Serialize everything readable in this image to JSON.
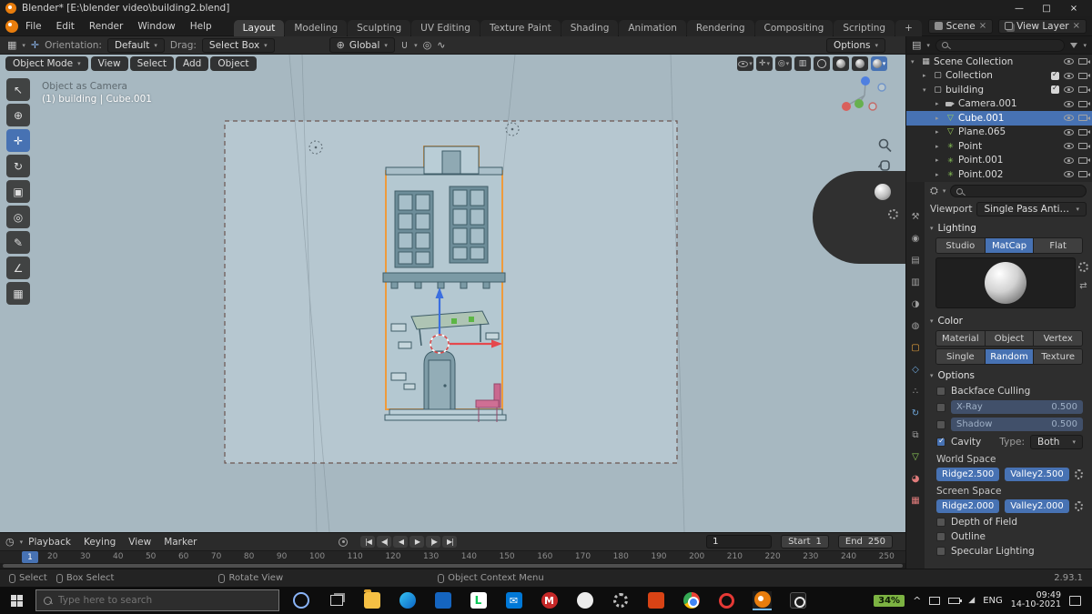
{
  "window": {
    "title": "Blender* [E:\\blender video\\building2.blend]",
    "controls": [
      "—",
      "□",
      "×"
    ]
  },
  "menubar": {
    "menus": [
      "File",
      "Edit",
      "Render",
      "Window",
      "Help"
    ],
    "tabs": [
      {
        "label": "Layout",
        "state": "active"
      },
      {
        "label": "Modeling"
      },
      {
        "label": "Sculpting"
      },
      {
        "label": "UV Editing"
      },
      {
        "label": "Texture Paint"
      },
      {
        "label": "Shading"
      },
      {
        "label": "Animation"
      },
      {
        "label": "Rendering"
      },
      {
        "label": "Compositing"
      },
      {
        "label": "Scripting"
      },
      {
        "label": "+"
      }
    ],
    "scene_label": "Scene",
    "view_layer_label": "View Layer"
  },
  "toolrow": {
    "orientation_label": "Orientation:",
    "orientation_value": "Default",
    "drag_label": "Drag:",
    "drag_value": "Select Box",
    "pivot": "Global",
    "options": "Options"
  },
  "vp": {
    "mode": "Object Mode",
    "menus": [
      "View",
      "Select",
      "Add",
      "Object"
    ],
    "overlay1": "Object as Camera",
    "overlay2": "(1) building | Cube.001"
  },
  "outliner": {
    "rows": [
      {
        "rowclass": "d0",
        "arrow": "▾",
        "icon": "icon-scene",
        "label": "Scene Collection"
      },
      {
        "rowclass": "d1 has-chk",
        "arrow": "▸",
        "icon": "icon-collection",
        "label": "Collection"
      },
      {
        "rowclass": "d1 has-chk",
        "arrow": "▾",
        "icon": "icon-collection",
        "label": "building"
      },
      {
        "rowclass": "d2",
        "arrow": "▸",
        "icon": "icon-camera",
        "label": "Camera.001"
      },
      {
        "rowclass": "d2 selected",
        "arrow": "▸",
        "icon": "icon-mesh",
        "label": "Cube.001"
      },
      {
        "rowclass": "d2",
        "arrow": "▸",
        "icon": "icon-mesh",
        "label": "Plane.065"
      },
      {
        "rowclass": "d2",
        "arrow": "▸",
        "icon": "icon-light",
        "label": "Point"
      },
      {
        "rowclass": "d2",
        "arrow": "▸",
        "icon": "icon-light",
        "label": "Point.001"
      },
      {
        "rowclass": "d2",
        "arrow": "▸",
        "icon": "icon-light",
        "label": "Point.002"
      }
    ]
  },
  "props": {
    "viewport_label": "Viewport",
    "viewport_value": "Single Pass Anti-Aliasing",
    "lighting_title": "Lighting",
    "lighting_tabs": [
      {
        "label": "Studio"
      },
      {
        "label": "MatCap",
        "state": "active"
      },
      {
        "label": "Flat"
      }
    ],
    "color_title": "Color",
    "color_row1": [
      {
        "label": "Material"
      },
      {
        "label": "Object"
      },
      {
        "label": "Vertex"
      }
    ],
    "color_row2": [
      {
        "label": "Single"
      },
      {
        "label": "Random",
        "state": "active"
      },
      {
        "label": "Texture"
      }
    ],
    "options_title": "Options",
    "backface": "Backface Culling",
    "xray_label": "X-Ray",
    "xray_value": "0.500",
    "shadow_label": "Shadow",
    "shadow_value": "0.500",
    "cavity_label": "Cavity",
    "type_label": "Type:",
    "type_value": "Both",
    "world_label": "World Space",
    "screen_label": "Screen Space",
    "ridge_label": "Ridge",
    "valley_label": "Valley",
    "world_ridge": "2.500",
    "world_valley": "2.500",
    "screen_ridge": "2.000",
    "screen_valley": "2.000",
    "dof": "Depth of Field",
    "outline": "Outline",
    "specular": "Specular Lighting"
  },
  "timeline": {
    "menus": [
      "Playback",
      "Keying",
      "View",
      "Marker"
    ],
    "transport": [
      "|◀",
      "◀|",
      "◀",
      "▶",
      "|▶",
      "▶|"
    ],
    "frames": [
      "20",
      "30",
      "40",
      "50",
      "60",
      "70",
      "80",
      "90",
      "100",
      "110",
      "120",
      "130",
      "140",
      "150",
      "160",
      "170",
      "180",
      "190",
      "200",
      "210",
      "220",
      "230",
      "240",
      "250"
    ],
    "current": "1",
    "playhead": "1",
    "start_label": "Start",
    "start_value": "1",
    "end_label": "End",
    "end_value": "250"
  },
  "status": {
    "items": [
      {
        "label": "Select"
      },
      {
        "label": "Box Select"
      },
      {
        "label": "Rotate View"
      },
      {
        "label": "Object Context Menu"
      }
    ],
    "version": "2.93.1"
  },
  "taskbar": {
    "search_placeholder": "Type here to search",
    "battery": "34%",
    "lang": "ENG",
    "time": "09:49",
    "date": "14-10-2021"
  }
}
